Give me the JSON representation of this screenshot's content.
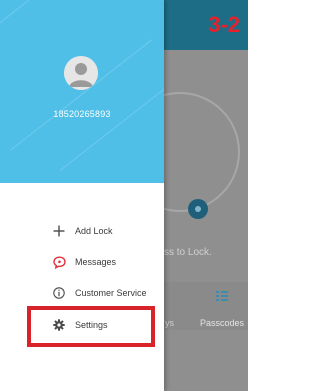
{
  "annotation": {
    "page_label": "3-2",
    "highlight_color": "#d9232a"
  },
  "colors": {
    "header_bg": "#4fbfe8",
    "top_bar": "#1e6d87"
  },
  "drawer": {
    "phone_number": "18520265893",
    "avatar_icon": "user-avatar-icon",
    "menu": [
      {
        "label": "Add Lock",
        "icon": "plus-icon"
      },
      {
        "label": "Messages",
        "icon": "message-icon"
      },
      {
        "label": "Customer Service",
        "icon": "info-icon"
      },
      {
        "label": "Settings",
        "icon": "gear-icon"
      }
    ]
  },
  "background_app": {
    "hint_text": "ss to Lock.",
    "tabs": [
      {
        "label": "ys",
        "icon": ""
      },
      {
        "label": "Passcodes",
        "icon": "passcodes-icon"
      }
    ]
  }
}
